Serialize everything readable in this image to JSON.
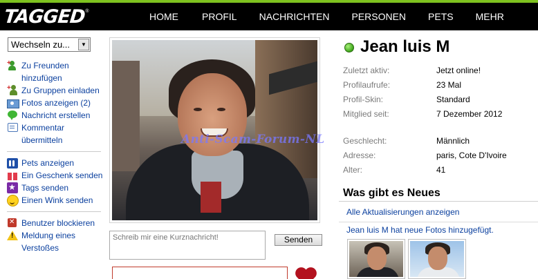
{
  "header": {
    "logo_text": "TAGGED",
    "logo_tm": "®",
    "nav": [
      "HOME",
      "PROFIL",
      "NACHRICHTEN",
      "PERSONEN",
      "PETS",
      "MEHR"
    ]
  },
  "sidebar": {
    "switch_select": "Wechseln zu...",
    "actions": [
      {
        "label": "Zu Freunden hinzufügen",
        "icon": "add-friend-icon"
      },
      {
        "label": "Zu Gruppen einladen",
        "icon": "group-invite-icon"
      },
      {
        "label": "Fotos anzeigen (2)",
        "icon": "photos-icon"
      },
      {
        "label": "Nachricht erstellen",
        "icon": "message-icon"
      },
      {
        "label": "Kommentar übermitteln",
        "icon": "comment-icon"
      },
      {
        "label": "Pets anzeigen",
        "icon": "pets-icon"
      },
      {
        "label": "Ein Geschenk senden",
        "icon": "gift-icon"
      },
      {
        "label": "Tags senden",
        "icon": "tag-star-icon"
      },
      {
        "label": "Einen Wink senden",
        "icon": "wink-icon"
      },
      {
        "label": "Benutzer blockieren",
        "icon": "block-icon"
      },
      {
        "label": "Meldung eines Verstoßes",
        "icon": "warning-icon"
      }
    ]
  },
  "photo": {
    "watermark": "Anti-Scam-Forum-NL"
  },
  "message": {
    "placeholder": "Schreib mir eine Kurznachricht!",
    "send_label": "Senden"
  },
  "profile": {
    "name": "Jean luis M",
    "online_color": "#3da51a",
    "info": [
      {
        "key": "Zuletzt aktiv:",
        "value": "Jetzt online!"
      },
      {
        "key": "Profilaufrufe:",
        "value": "23 Mal"
      },
      {
        "key": "Profil-Skin:",
        "value": "Standard"
      },
      {
        "key": "Mitglied seit:",
        "value": "7 Dezember 2012"
      },
      {
        "key": "Geschlecht:",
        "value": "Männlich"
      },
      {
        "key": "Adresse:",
        "value": "paris, Cote D'Ivoire"
      },
      {
        "key": "Alter:",
        "value": "41"
      }
    ]
  },
  "news": {
    "heading": "Was gibt es Neues",
    "all_updates": "Alle Aktualisierungen anzeigen",
    "item_name": "Jean luis M",
    "item_text": " hat neue Fotos hinzugefügt."
  },
  "colors": {
    "nav_bg": "#000000",
    "accent_green": "#7ec21f",
    "link_blue": "#0a3f9e"
  }
}
